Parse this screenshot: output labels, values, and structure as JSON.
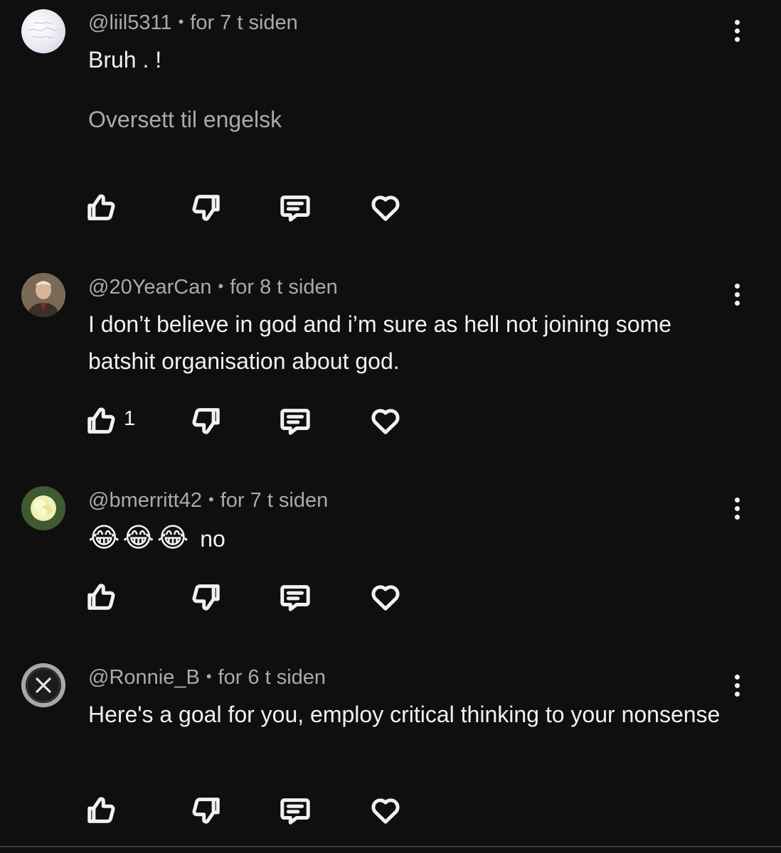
{
  "comments": [
    {
      "handle": "@liil5311",
      "time": "for 7 t siden",
      "text": "Bruh . !",
      "translate": "Oversett til engelsk",
      "likes": ""
    },
    {
      "handle": "@20YearCan",
      "time": "for 8 t siden",
      "text": "I don’t believe in god and i’m sure as hell not joining some batshit organisation about god.",
      "likes": "1"
    },
    {
      "handle": "@bmerritt42",
      "time": "for 7 t siden",
      "text": "no",
      "emoji": "😂😂😂",
      "likes": ""
    },
    {
      "handle": "@Ronnie_B",
      "time": "for 6 t siden",
      "text": "Here's a goal for you, employ critical thinking to your nonsense",
      "likes": ""
    }
  ],
  "meta_separator": "•",
  "icons": {
    "like": "thumbs-up-icon",
    "dislike": "thumbs-down-icon",
    "reply": "reply-comment-icon",
    "heart": "heart-icon",
    "menu": "more-vertical-icon"
  },
  "colors": {
    "background": "#0f0f0f",
    "primary_text": "#f1f1f1",
    "secondary_text": "#aaaaaa"
  }
}
